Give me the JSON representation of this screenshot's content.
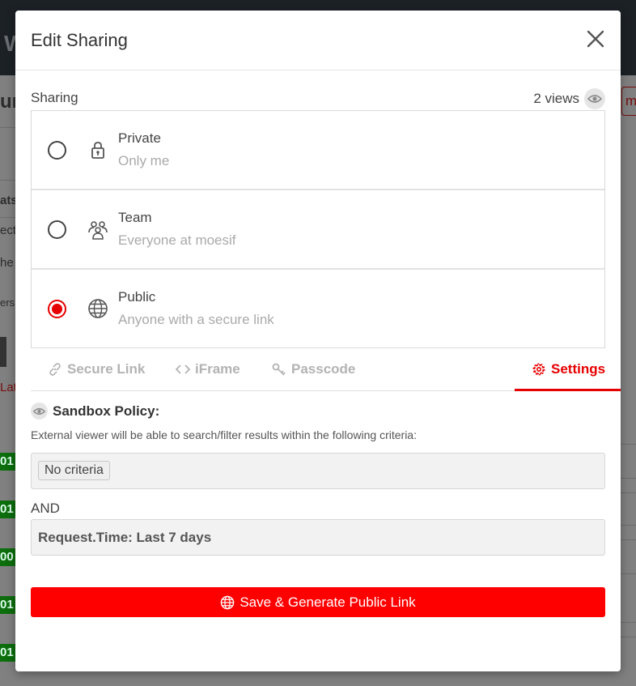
{
  "background": {
    "fragments": [
      "W",
      "ur",
      "mbe",
      "ats",
      "ect",
      "he",
      "ers",
      "Lat"
    ],
    "green_badges": [
      "01",
      "01",
      "00",
      "01",
      "01"
    ]
  },
  "modal": {
    "title": "Edit Sharing",
    "close_icon": "close-icon"
  },
  "sharing": {
    "label": "Sharing",
    "views": "2 views",
    "options": [
      {
        "title": "Private",
        "subtitle": "Only me",
        "icon": "lock-icon",
        "checked": false
      },
      {
        "title": "Team",
        "subtitle": "Everyone at moesif",
        "icon": "team-icon",
        "checked": false
      },
      {
        "title": "Public",
        "subtitle": "Anyone with a secure link",
        "icon": "globe-icon",
        "checked": true
      }
    ]
  },
  "tabs": [
    {
      "label": "Secure Link",
      "icon": "link-icon",
      "active": false
    },
    {
      "label": "iFrame",
      "icon": "code-icon",
      "active": false
    },
    {
      "label": "Passcode",
      "icon": "key-icon",
      "active": false
    },
    {
      "label": "Settings",
      "icon": "gear-icon",
      "active": true
    }
  ],
  "settings": {
    "policy_title": "Sandbox Policy:",
    "policy_description": "External viewer will be able to search/filter results within the following criteria:",
    "criteria_chip": "No criteria",
    "and_label": "AND",
    "time_filter": "Request.Time: Last 7 days"
  },
  "save_button": {
    "label": "Save & Generate Public Link"
  },
  "colors": {
    "accent": "#e60000",
    "button": "#ff0000",
    "overlay": "#808080"
  }
}
